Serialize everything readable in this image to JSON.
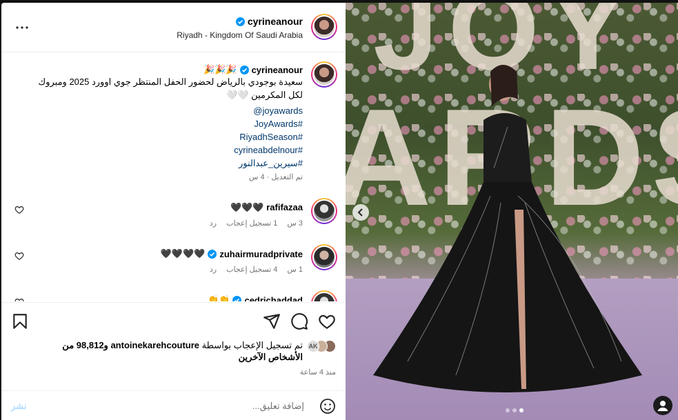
{
  "post": {
    "author": "cyrineanour",
    "location": "Riyadh - Kingdom Of Saudi Arabia",
    "caption": {
      "author": "cyrineanour",
      "prefix_emoji": "🎉🎉🎉",
      "text": "سعيدة بوجودي بالرياض لحضور الحفل المنتظر جوي اوورد 2025 ومبروك لكل المكرمين 🤍🤍",
      "links": [
        "joyawards@",
        "#JoyAwards",
        "#RiyadhSeason",
        "#cyrineabdelnour",
        "#سيرين_عبدالنور"
      ],
      "meta": "تم التعديل · 4 س"
    },
    "comments": [
      {
        "user": "rafifazaa",
        "verified": false,
        "text": "🖤🖤🖤",
        "time": "3 س",
        "likes": "1 تسجيل إعجاب",
        "reply": "رد"
      },
      {
        "user": "zuhairmuradprivate",
        "verified": true,
        "text": "🖤🖤🖤🖤",
        "time": "1 س",
        "likes": "4 تسجيل إعجاب",
        "reply": "رد"
      },
      {
        "user": "cedrichaddad",
        "verified": true,
        "text": "👏👏",
        "time": "",
        "likes": "",
        "reply": ""
      }
    ],
    "likes_text_prefix": "تم تسجيل الإعجاب بواسطة",
    "likes_user": "antoinekarehcouture",
    "likes_text_suffix": "و98,812 من الأشخاص الآخرين",
    "time_ago": "منذ 4 ساعة",
    "comment_placeholder": "إضافة تعليق...",
    "post_button": "نشر"
  },
  "photo": {
    "sign_text": "JOY AWARDS",
    "carousel_dots": 3,
    "active_dot": 2
  },
  "colors": {
    "link": "#00376b",
    "muted": "#737373",
    "verified": "#0095f6"
  }
}
